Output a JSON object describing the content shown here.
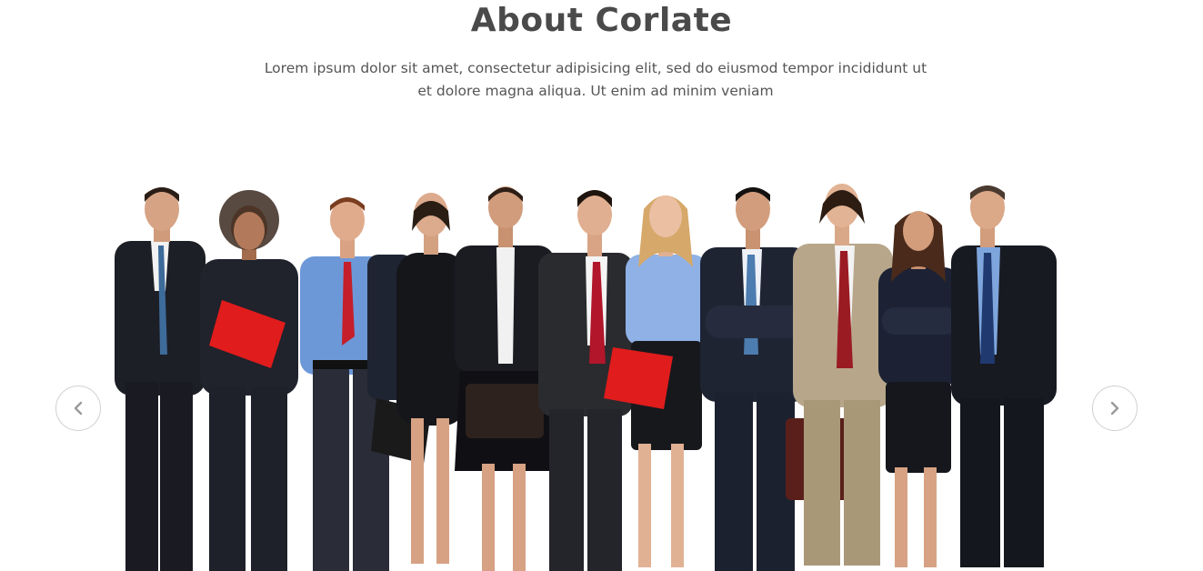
{
  "section": {
    "title": "About Corlate",
    "description": "Lorem ipsum dolor sit amet, consectetur adipisicing elit, sed do eiusmod tempor incididunt ut et dolore magna aliqua. Ut enim ad minim veniam"
  },
  "slider": {
    "prev_icon": "chevron-left-icon",
    "next_icon": "chevron-right-icon",
    "image_subject": "group of business people",
    "colors": {
      "suit_dark": "#1d1f26",
      "suit_navy": "#1f2433",
      "shirt_blue": "#6d98d8",
      "skin": "#d8a585",
      "accent_red": "#e01c1c",
      "suit_tan": "#b7a68a",
      "arrow_border": "#d0d0d0",
      "arrow_glyph": "#9a9a9a"
    }
  }
}
